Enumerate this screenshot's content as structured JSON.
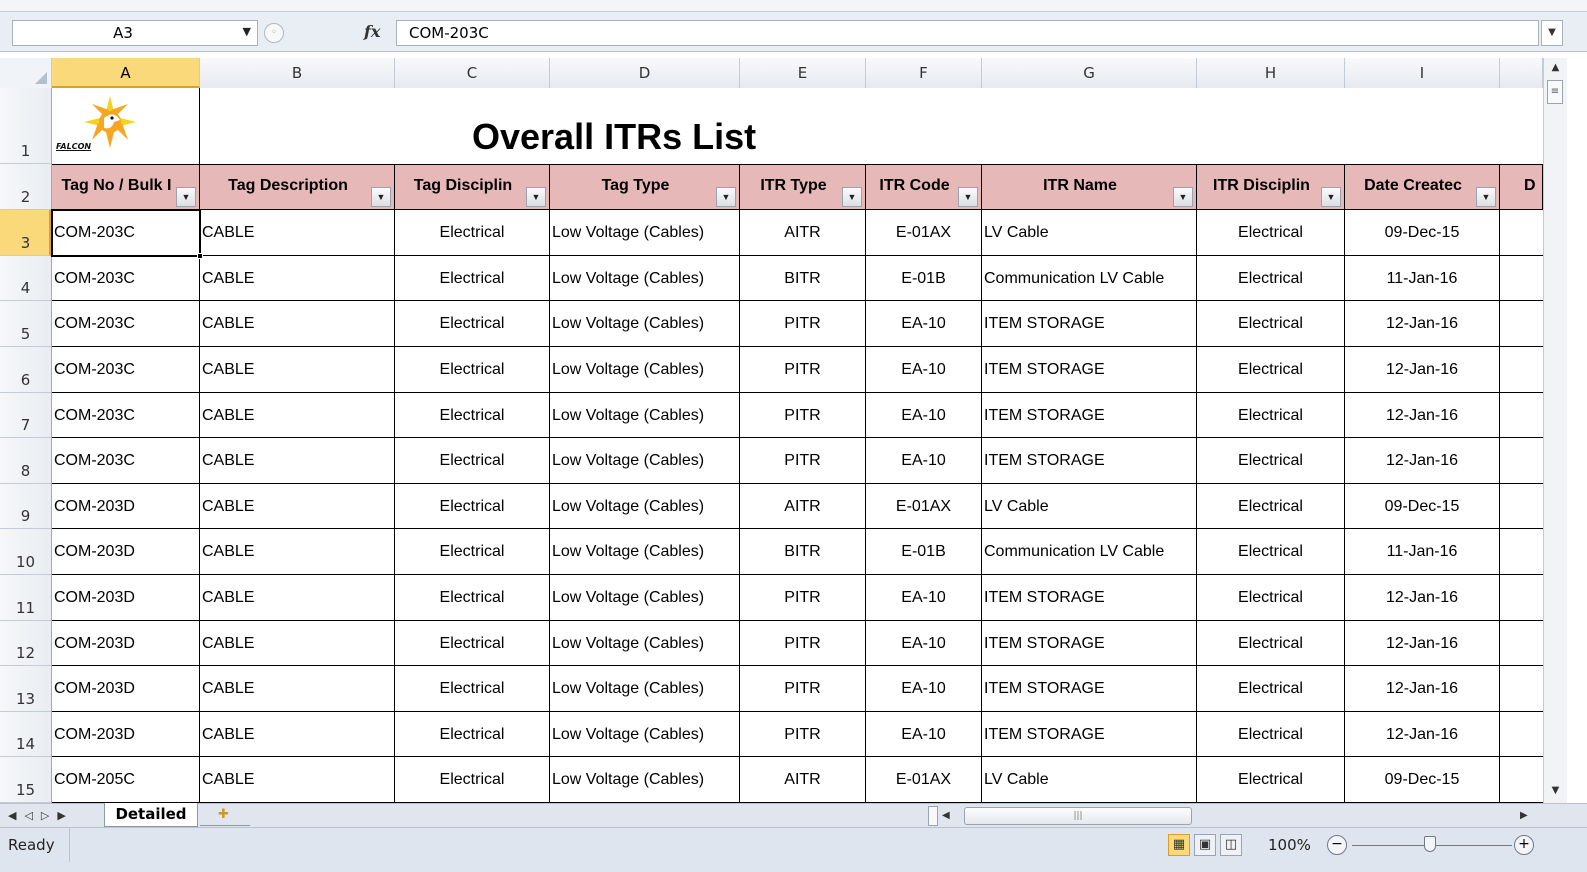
{
  "formula_bar": {
    "name_box": "A3",
    "fx_label": "fx",
    "formula_value": "COM-203C"
  },
  "columns": [
    "A",
    "B",
    "C",
    "D",
    "E",
    "F",
    "G",
    "H",
    "I"
  ],
  "rows": [
    "1",
    "2",
    "3",
    "4",
    "5",
    "6",
    "7",
    "8",
    "9",
    "10",
    "11",
    "12",
    "13",
    "14",
    "15"
  ],
  "sheet": {
    "title": "Overall ITRs List",
    "logo_text": "FALCON",
    "headers": [
      "Tag No / Bulk I",
      "Tag Description",
      "Tag Disciplin",
      "Tag Type",
      "ITR Type",
      "ITR Code",
      "ITR Name",
      "ITR Disciplin",
      "Date Createc",
      "D"
    ],
    "data": [
      [
        "COM-203C",
        "CABLE",
        "Electrical",
        "Low Voltage (Cables)",
        "AITR",
        "E-01AX",
        "LV Cable",
        "Electrical",
        "09-Dec-15"
      ],
      [
        "COM-203C",
        "CABLE",
        "Electrical",
        "Low Voltage (Cables)",
        "BITR",
        "E-01B",
        "Communication LV Cable",
        "Electrical",
        "11-Jan-16"
      ],
      [
        "COM-203C",
        "CABLE",
        "Electrical",
        "Low Voltage (Cables)",
        "PITR",
        "EA-10",
        "ITEM STORAGE",
        "Electrical",
        "12-Jan-16"
      ],
      [
        "COM-203C",
        "CABLE",
        "Electrical",
        "Low Voltage (Cables)",
        "PITR",
        "EA-10",
        "ITEM STORAGE",
        "Electrical",
        "12-Jan-16"
      ],
      [
        "COM-203C",
        "CABLE",
        "Electrical",
        "Low Voltage (Cables)",
        "PITR",
        "EA-10",
        "ITEM STORAGE",
        "Electrical",
        "12-Jan-16"
      ],
      [
        "COM-203C",
        "CABLE",
        "Electrical",
        "Low Voltage (Cables)",
        "PITR",
        "EA-10",
        "ITEM STORAGE",
        "Electrical",
        "12-Jan-16"
      ],
      [
        "COM-203D",
        "CABLE",
        "Electrical",
        "Low Voltage (Cables)",
        "AITR",
        "E-01AX",
        "LV Cable",
        "Electrical",
        "09-Dec-15"
      ],
      [
        "COM-203D",
        "CABLE",
        "Electrical",
        "Low Voltage (Cables)",
        "BITR",
        "E-01B",
        "Communication LV Cable",
        "Electrical",
        "11-Jan-16"
      ],
      [
        "COM-203D",
        "CABLE",
        "Electrical",
        "Low Voltage (Cables)",
        "PITR",
        "EA-10",
        "ITEM STORAGE",
        "Electrical",
        "12-Jan-16"
      ],
      [
        "COM-203D",
        "CABLE",
        "Electrical",
        "Low Voltage (Cables)",
        "PITR",
        "EA-10",
        "ITEM STORAGE",
        "Electrical",
        "12-Jan-16"
      ],
      [
        "COM-203D",
        "CABLE",
        "Electrical",
        "Low Voltage (Cables)",
        "PITR",
        "EA-10",
        "ITEM STORAGE",
        "Electrical",
        "12-Jan-16"
      ],
      [
        "COM-203D",
        "CABLE",
        "Electrical",
        "Low Voltage (Cables)",
        "PITR",
        "EA-10",
        "ITEM STORAGE",
        "Electrical",
        "12-Jan-16"
      ],
      [
        "COM-205C",
        "CABLE",
        "Electrical",
        "Low Voltage (Cables)",
        "AITR",
        "E-01AX",
        "LV Cable",
        "Electrical",
        "09-Dec-15"
      ]
    ]
  },
  "tabs": {
    "active": "Detailed"
  },
  "status": {
    "text": "Ready",
    "zoom": "100%",
    "zoom_level_percent": 100
  },
  "colors": {
    "header_fill": "#e6b8b7",
    "selected_header": "#f9d97a",
    "logo_orange": "#f5a623",
    "logo_yellow": "#f7d21c"
  }
}
